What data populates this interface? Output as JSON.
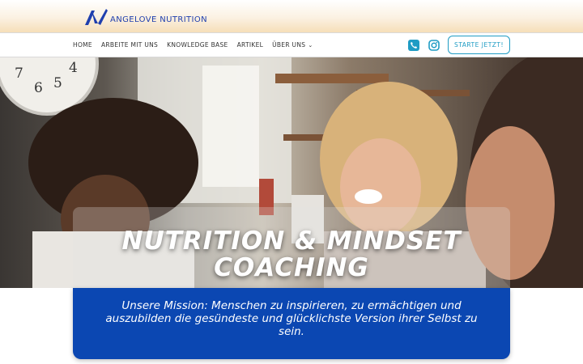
{
  "brand": {
    "name": "ANGELOVE NUTRITION",
    "logo_icon": "angelove-logo-icon",
    "primary_color": "#1f3fae"
  },
  "nav": {
    "items": [
      {
        "label": "HOME"
      },
      {
        "label": "ARBEITE MIT UNS"
      },
      {
        "label": "KNOWLEDGE BASE"
      },
      {
        "label": "ARTIKEL"
      },
      {
        "label": "ÜBER UNS",
        "has_dropdown": true
      }
    ],
    "dropdown_caret": "⌄",
    "social": [
      {
        "icon": "phone-icon"
      },
      {
        "icon": "instagram-icon"
      }
    ],
    "cta_label": "STARTE JETZT!",
    "accent_color": "#1f9cc4"
  },
  "hero": {
    "title": "NUTRITION & MINDSET COACHING",
    "image": "Photo of laughing women in a kitchen"
  },
  "mission": {
    "text": "Unsere Mission: Menschen zu inspirieren, zu ermächtigen und auszubilden die gesündeste und glücklichste Version ihrer Selbst zu sein.",
    "background_color": "#0b47b2"
  }
}
